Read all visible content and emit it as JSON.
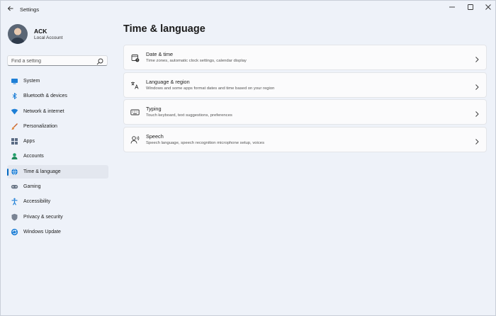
{
  "window": {
    "app_title": "Settings",
    "back_icon": "back-arrow-icon",
    "controls": [
      "minimize-icon",
      "maximize-icon",
      "close-icon"
    ]
  },
  "profile": {
    "name": "ACK",
    "account_type": "Local Account"
  },
  "search": {
    "placeholder": "Find a setting",
    "icon": "search-icon"
  },
  "sidebar": {
    "items": [
      {
        "label": "System",
        "icon": "system-icon",
        "selected": false
      },
      {
        "label": "Bluetooth & devices",
        "icon": "bluetooth-icon",
        "selected": false
      },
      {
        "label": "Network & internet",
        "icon": "network-icon",
        "selected": false
      },
      {
        "label": "Personalization",
        "icon": "personalization-icon",
        "selected": false
      },
      {
        "label": "Apps",
        "icon": "apps-icon",
        "selected": false
      },
      {
        "label": "Accounts",
        "icon": "accounts-icon",
        "selected": false
      },
      {
        "label": "Time & language",
        "icon": "time-language-icon",
        "selected": true
      },
      {
        "label": "Gaming",
        "icon": "gaming-icon",
        "selected": false
      },
      {
        "label": "Accessibility",
        "icon": "accessibility-icon",
        "selected": false
      },
      {
        "label": "Privacy & security",
        "icon": "privacy-icon",
        "selected": false
      },
      {
        "label": "Windows Update",
        "icon": "windows-update-icon",
        "selected": false
      }
    ]
  },
  "main": {
    "title": "Time & language",
    "cards": [
      {
        "title": "Date & time",
        "description": "Time zones, automatic clock settings, calendar display",
        "icon": "date-time-icon"
      },
      {
        "title": "Language & region",
        "description": "Windows and some apps format dates and time based on your region",
        "icon": "language-icon"
      },
      {
        "title": "Typing",
        "description": "Touch keyboard, text suggestions, preferences",
        "icon": "keyboard-icon"
      },
      {
        "title": "Speech",
        "description": "Speech language, speech recognition microphone setup, voices",
        "icon": "speech-icon"
      }
    ]
  },
  "colors": {
    "accent": "#0067c0",
    "background": "#eef2f9",
    "card": "#fbfbfc"
  }
}
